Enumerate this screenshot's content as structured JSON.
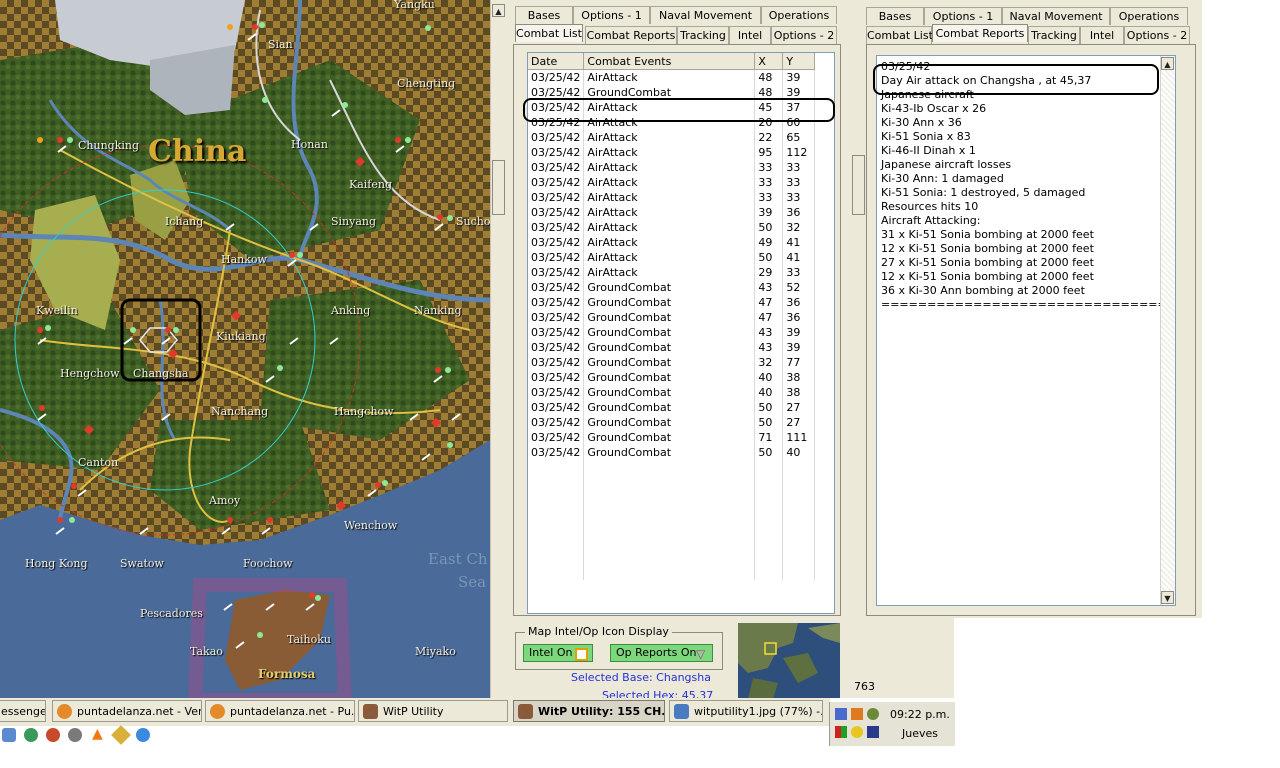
{
  "map": {
    "region_label": "China",
    "sea_label_1": "East Ch",
    "sea_label_2": "Sea",
    "island_label": "Formosa",
    "cities": [
      "Sian",
      "Yangku",
      "Chungking",
      "Honan",
      "Chengting",
      "Kaifeng",
      "Ichang",
      "Sinyang",
      "Suchow",
      "Hankow",
      "Kweilin",
      "Kiukiang",
      "Anking",
      "Nanking",
      "Changsha",
      "Hengchow",
      "Nanchang",
      "Hangchow",
      "Canton",
      "Amoy",
      "Wenchow",
      "Hong Kong",
      "Swatow",
      "Foochow",
      "Pescadores",
      "Taihoku",
      "Takao",
      "Miyako"
    ]
  },
  "combat_list": {
    "tabs_row1": [
      "Bases",
      "Options - 1",
      "Naval Movement",
      "Operations"
    ],
    "tabs_row2": [
      "Combat List",
      "Combat Reports",
      "Tracking",
      "Intel",
      "Options - 2"
    ],
    "active_tab": "Combat List",
    "columns": [
      "Date",
      "Combat Events",
      "X",
      "Y"
    ],
    "rows": [
      [
        "03/25/42",
        "AirAttack",
        "48",
        "39"
      ],
      [
        "03/25/42",
        "GroundCombat",
        "48",
        "39"
      ],
      [
        "03/25/42",
        "AirAttack",
        "45",
        "37"
      ],
      [
        "03/25/42",
        "AirAttack",
        "20",
        "60"
      ],
      [
        "03/25/42",
        "AirAttack",
        "22",
        "65"
      ],
      [
        "03/25/42",
        "AirAttack",
        "95",
        "112"
      ],
      [
        "03/25/42",
        "AirAttack",
        "33",
        "33"
      ],
      [
        "03/25/42",
        "AirAttack",
        "33",
        "33"
      ],
      [
        "03/25/42",
        "AirAttack",
        "33",
        "33"
      ],
      [
        "03/25/42",
        "AirAttack",
        "39",
        "36"
      ],
      [
        "03/25/42",
        "AirAttack",
        "50",
        "32"
      ],
      [
        "03/25/42",
        "AirAttack",
        "49",
        "41"
      ],
      [
        "03/25/42",
        "AirAttack",
        "50",
        "41"
      ],
      [
        "03/25/42",
        "AirAttack",
        "29",
        "33"
      ],
      [
        "03/25/42",
        "GroundCombat",
        "43",
        "52"
      ],
      [
        "03/25/42",
        "GroundCombat",
        "47",
        "36"
      ],
      [
        "03/25/42",
        "GroundCombat",
        "47",
        "36"
      ],
      [
        "03/25/42",
        "GroundCombat",
        "43",
        "39"
      ],
      [
        "03/25/42",
        "GroundCombat",
        "43",
        "39"
      ],
      [
        "03/25/42",
        "GroundCombat",
        "32",
        "77"
      ],
      [
        "03/25/42",
        "GroundCombat",
        "40",
        "38"
      ],
      [
        "03/25/42",
        "GroundCombat",
        "40",
        "38"
      ],
      [
        "03/25/42",
        "GroundCombat",
        "50",
        "27"
      ],
      [
        "03/25/42",
        "GroundCombat",
        "50",
        "27"
      ],
      [
        "03/25/42",
        "GroundCombat",
        "71",
        "111"
      ],
      [
        "03/25/42",
        "GroundCombat",
        "50",
        "40"
      ]
    ],
    "map_icon_display": {
      "title": "Map Intel/Op Icon Display",
      "intel_btn": "Intel On",
      "op_btn": "Op Reports On"
    },
    "selected_base": "Selected Base: Changsha",
    "selected_hex": "Selected Hex: 45,37"
  },
  "combat_reports": {
    "tabs_row1": [
      "Bases",
      "Options - 1",
      "Naval Movement",
      "Operations"
    ],
    "tabs_row2": [
      "Combat List",
      "Combat Reports",
      "Tracking",
      "Intel",
      "Options - 2"
    ],
    "active_tab": "Combat Reports",
    "lines": [
      "03/25/42",
      "Day Air attack on Changsha , at 45,37",
      "Japanese aircraft",
      "Ki-43-Ib Oscar x 26",
      "Ki-30 Ann x 36",
      "Ki-51 Sonia x 83",
      "Ki-46-II Dinah x 1",
      "Japanese aircraft losses",
      "Ki-30 Ann: 1 damaged",
      "Ki-51 Sonia: 1 destroyed, 5 damaged",
      "Resources hits 10",
      "Aircraft Attacking:",
      "31 x Ki-51 Sonia bombing at 2000 feet",
      "12 x Ki-51 Sonia bombing at 2000 feet",
      "27 x Ki-51 Sonia bombing at 2000 feet",
      "12 x Ki-51 Sonia bombing at 2000 feet",
      "36 x Ki-30 Ann bombing at 2000 feet",
      "================================================"
    ],
    "status_text": "763"
  },
  "taskbar": {
    "items": [
      "essenger",
      "puntadelanza.net - Ver...",
      "puntadelanza.net - Pu...",
      "WitP Utility",
      "WitP Utility:  155 CH...",
      "witputility1.jpg (77%) -..."
    ],
    "active_index": 4,
    "clock_time": "09:22 p.m.",
    "clock_day": "Jueves"
  }
}
